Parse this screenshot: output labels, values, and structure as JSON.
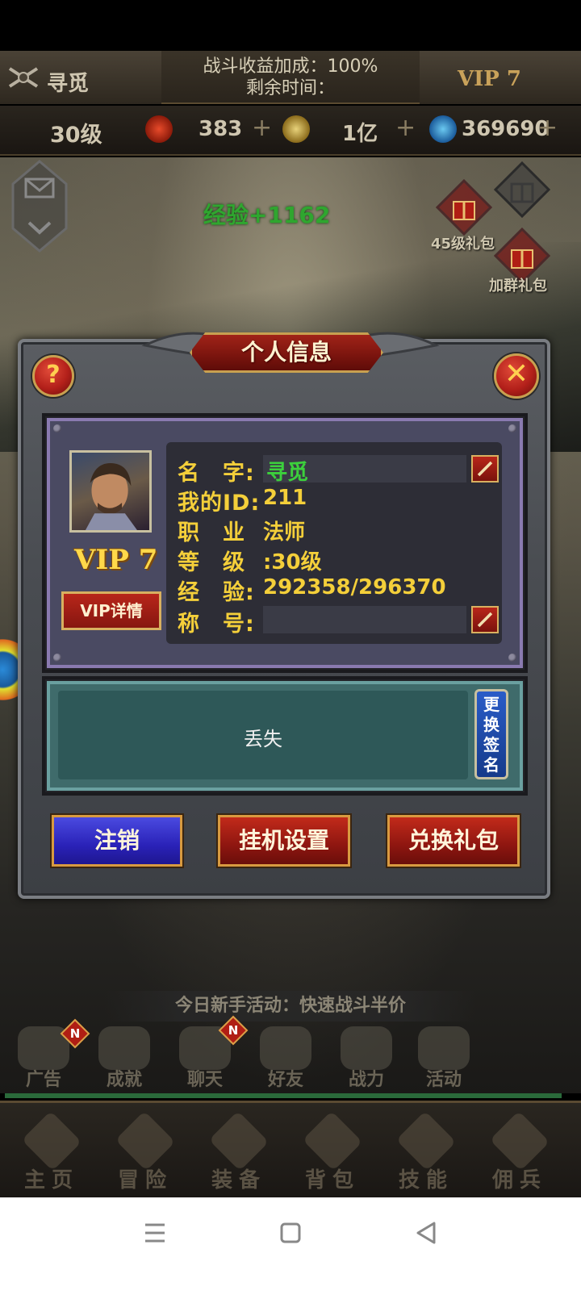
{
  "header": {
    "player_name": "寻觅",
    "bonus_line1": "战斗收益加成：100%",
    "bonus_line2": "剩余时间：",
    "vip_label": "VIP 7"
  },
  "resources": {
    "level": "30级",
    "energy": "383",
    "gold": "1亿",
    "diamonds": "369690"
  },
  "events": {
    "exp_gain": "经验+1162",
    "gift_45": "45级礼包",
    "gift_group": "加群礼包"
  },
  "dialog": {
    "title": "个人信息",
    "help_symbol": "?",
    "close_symbol": "✕",
    "vip_badge": "VIP 7",
    "vip_detail_button": "VIP详情",
    "fields": {
      "name_label": "名　字:",
      "name_value": "寻觅",
      "id_label": "我的ID:",
      "id_value": "211",
      "job_label": "职　业",
      "job_value": "法师",
      "level_label": "等　级",
      "level_value": ":30级",
      "exp_label": "经　验:",
      "exp_value": "292358/296370",
      "title_label": "称　号:",
      "title_value": ""
    },
    "signature": "丢失",
    "signature_button": "更换签名",
    "buttons": {
      "logout": "注销",
      "afk_settings": "挂机设置",
      "redeem_gift": "兑换礼包"
    }
  },
  "ticker": "今日新手活动：快速战斗半价",
  "function_row": [
    {
      "label": "广告",
      "badge": "N"
    },
    {
      "label": "成就",
      "badge": ""
    },
    {
      "label": "聊天",
      "badge": "N"
    },
    {
      "label": "好友",
      "badge": ""
    },
    {
      "label": "战力",
      "badge": ""
    },
    {
      "label": "活动",
      "badge": ""
    }
  ],
  "nav": [
    {
      "label": "主页"
    },
    {
      "label": "冒险"
    },
    {
      "label": "装备"
    },
    {
      "label": "背包"
    },
    {
      "label": "技能"
    },
    {
      "label": "佣兵"
    }
  ],
  "colors": {
    "gold_text": "#f4cf3a",
    "green_text": "#3cd03c",
    "button_red": "#8e1610",
    "button_blue": "#2a22b8",
    "frame_purple": "#8a7ab0"
  }
}
